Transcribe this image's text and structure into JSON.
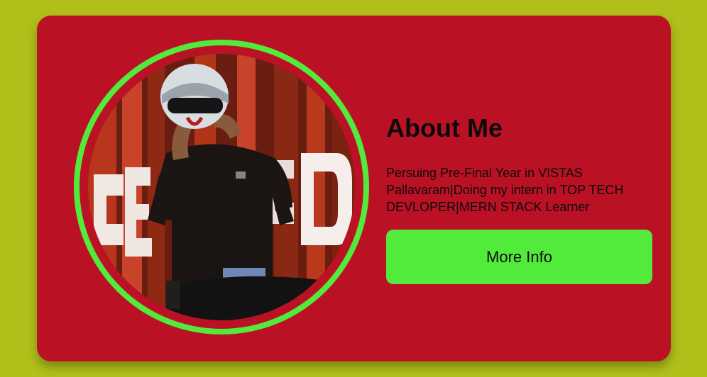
{
  "about": {
    "title": "About Me",
    "bio": "Persuing Pre-Final Year in VISTAS Pallavaram|Doing my intern in TOP TECH DEVLOPER|MERN STACK Learner",
    "button_label": "More Info"
  },
  "photo": {
    "icon": "profile-photo"
  },
  "colors": {
    "page_background": "#b0bf1a",
    "card_background": "#bb1125",
    "accent": "#52eb3b",
    "text": "#0b0b0b"
  }
}
